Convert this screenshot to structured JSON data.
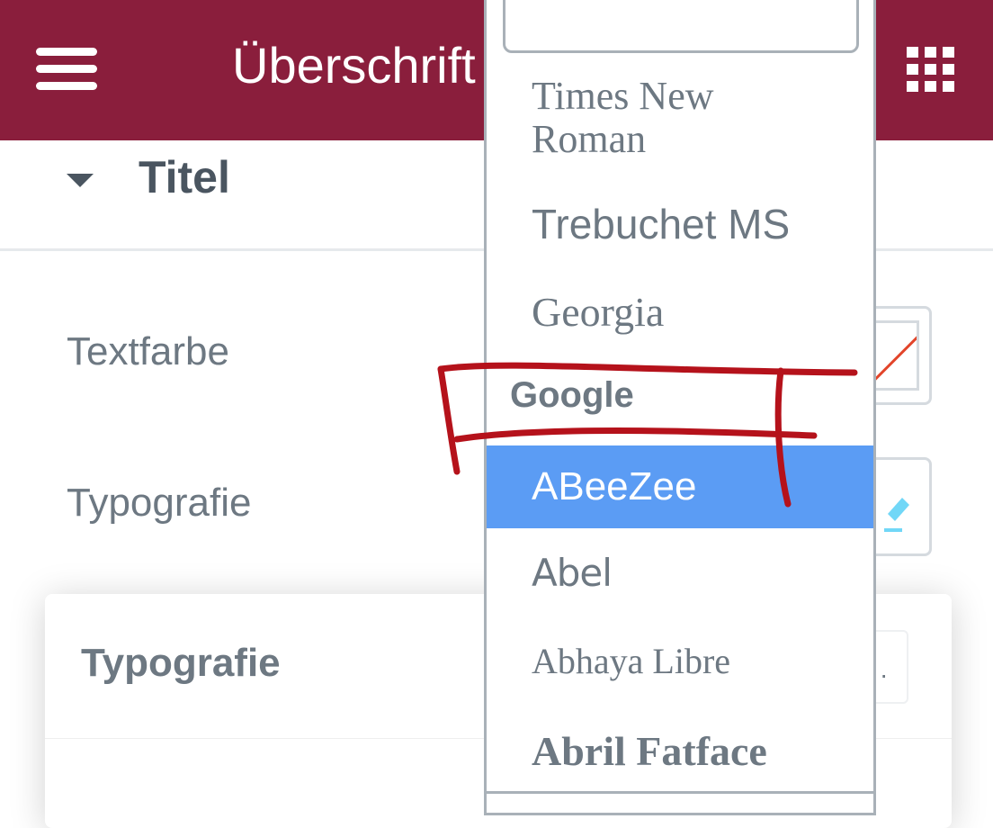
{
  "header": {
    "title": "Überschrift",
    "menu_icon": "hamburger-menu-icon",
    "apps_icon": "grid-icon",
    "bg_color": "#8a1e3c"
  },
  "section": {
    "title": "Titel",
    "caret_icon": "caret-down-icon"
  },
  "fields": {
    "text_color_label": "Textfarbe",
    "typography_label": "Typografie"
  },
  "popup": {
    "title": "Typografie"
  },
  "dropdown": {
    "search_value": "",
    "options": [
      {
        "label": "Times New Roman",
        "type": "font"
      },
      {
        "label": "Trebuchet MS",
        "type": "font"
      },
      {
        "label": "Georgia",
        "type": "font"
      },
      {
        "label": "Google",
        "type": "group"
      },
      {
        "label": "ABeeZee",
        "type": "font",
        "selected": true
      },
      {
        "label": "Abel",
        "type": "font"
      },
      {
        "label": "Abhaya Libre",
        "type": "font"
      },
      {
        "label": "Abril Fatface",
        "type": "font"
      }
    ],
    "selected_color": "#5b9cf4"
  }
}
